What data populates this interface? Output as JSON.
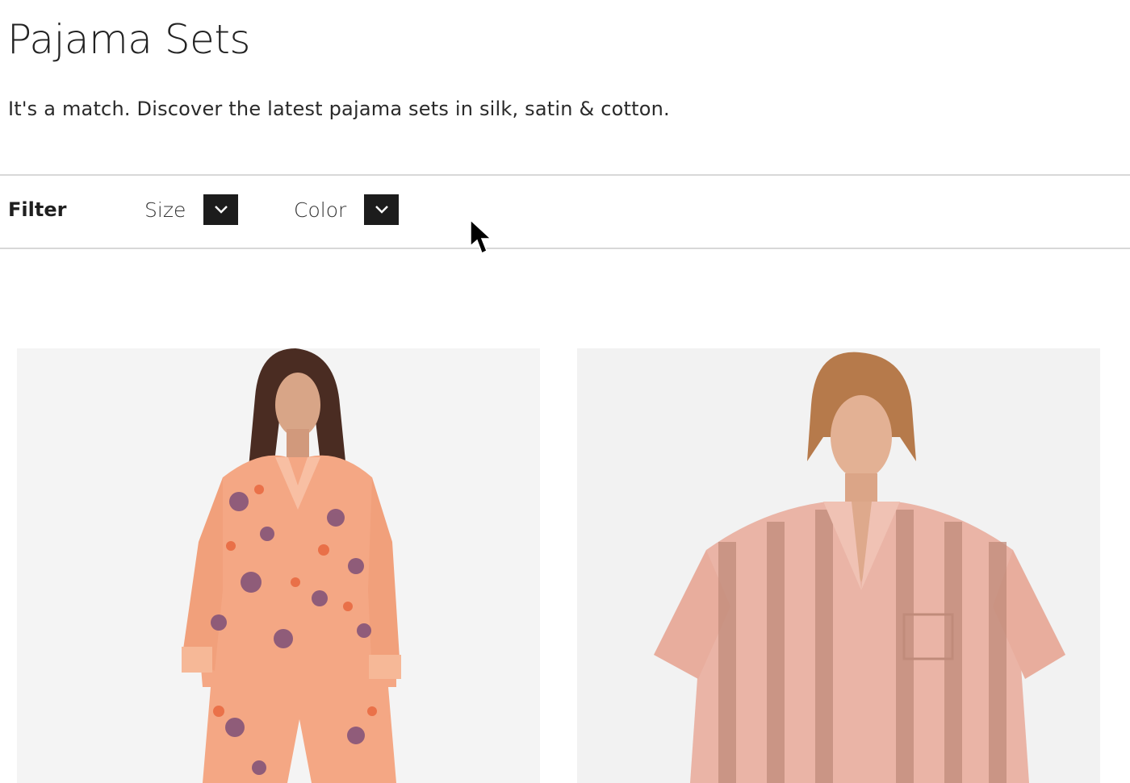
{
  "page": {
    "title": "Pajama Sets",
    "subtitle": "It's a match. Discover the latest pajama sets in silk, satin & cotton."
  },
  "filters": {
    "heading": "Filter",
    "items": [
      {
        "label": "Size",
        "icon": "chevron-down-icon"
      },
      {
        "label": "Color",
        "icon": "chevron-down-icon"
      }
    ]
  },
  "products": [
    {
      "image": "product-image-floral-satin-pajama-set",
      "colors": {
        "fabric": "#f4a784",
        "print": "#7e4f78",
        "accent": "#e8673e"
      }
    },
    {
      "image": "product-image-striped-satin-pajama-set",
      "colors": {
        "fabric": "#eab4a6",
        "stripe": "#c08b7a"
      }
    }
  ],
  "colors": {
    "text": "#1f1f1f",
    "divider": "#d8d8d8",
    "dropdown_bg": "#1c1c1c",
    "dropdown_icon": "#ffffff"
  }
}
